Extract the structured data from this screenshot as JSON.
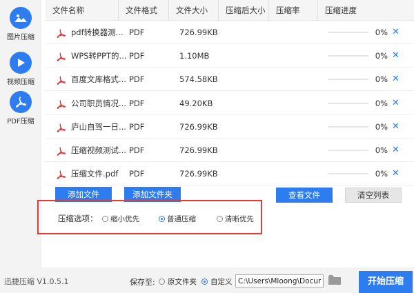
{
  "sidebar": {
    "items": [
      {
        "label": "图片压缩",
        "icon": "image-icon"
      },
      {
        "label": "视频压缩",
        "icon": "play-icon"
      },
      {
        "label": "PDF压缩",
        "icon": "pdf-icon"
      }
    ]
  },
  "table": {
    "headers": [
      "文件名称",
      "文件格式",
      "文件大小",
      "压缩后大小",
      "压缩率",
      "压缩进度"
    ],
    "rows": [
      {
        "name": "pdf转换器测...",
        "format": "PDF",
        "size": "726.99KB",
        "progress": "0%",
        "progress_value": 0
      },
      {
        "name": "WPS转PPT的...",
        "format": "PDF",
        "size": "1.10MB",
        "progress": "0%",
        "progress_value": 0
      },
      {
        "name": "百度文库格式...",
        "format": "PDF",
        "size": "574.58KB",
        "progress": "0%",
        "progress_value": 0
      },
      {
        "name": "公司职员情况...",
        "format": "PDF",
        "size": "49.20KB",
        "progress": "0%",
        "progress_value": 0
      },
      {
        "name": "庐山自驾一日...",
        "format": "PDF",
        "size": "726.99KB",
        "progress": "0%",
        "progress_value": 0
      },
      {
        "name": "压缩视频测试...",
        "format": "PDF",
        "size": "726.99KB",
        "progress": "0%",
        "progress_value": 0
      },
      {
        "name": "压缩文件.pdf",
        "format": "PDF",
        "size": "726.99KB",
        "progress": "0%",
        "progress_value": 0
      }
    ],
    "delete_glyph": "✕"
  },
  "buttons": {
    "add_file": "添加文件",
    "add_folder": "添加文件夹",
    "view_file": "查看文件",
    "clear_list": "清空列表"
  },
  "options": {
    "title": "压缩选项：",
    "choices": [
      "缩小优先",
      "普通压缩",
      "清晰优先"
    ],
    "selected": "普通压缩"
  },
  "footer": {
    "version": "迅捷压缩 V1.0.5.1",
    "save_to_label": "保存至:",
    "save_choices": [
      "原文件夹",
      "自定义"
    ],
    "save_selected": "自定义",
    "path_value": "C:\\Users\\Mloong\\Documents",
    "start_button": "开始压缩"
  },
  "colors": {
    "accent": "#2d7df0",
    "highlight_border": "#e53935",
    "pdf_red": "#e0322c"
  }
}
